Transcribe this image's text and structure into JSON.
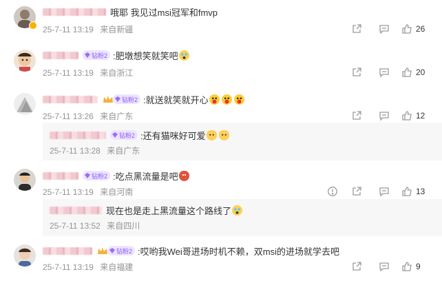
{
  "comments": [
    {
      "text": "哦耶 我见过msi冠军和fmvp",
      "date": "25-7-11 13:19",
      "location": "来自新疆",
      "likes": "26"
    },
    {
      "badge": "钻粉2",
      "text": ":肥墩想笑就笑吧",
      "date": "25-7-11 13:19",
      "location": "来自浙江",
      "likes": "20"
    },
    {
      "badge": "钻粉2",
      "text": ":就送就笑就开心",
      "date": "25-7-11 13:26",
      "location": "来自广东",
      "likes": "12",
      "reply": {
        "badge": "钻粉2",
        "text": ":还有猫咪好可爱",
        "date": "25-7-11 13:28",
        "location": "来自广东"
      }
    },
    {
      "badge": "钻粉2",
      "text": ":吃点黑流量是吧",
      "date": "25-7-11 13:19",
      "location": "来自河南",
      "likes": "13",
      "reply": {
        "text": "现在也是走上黑流量这个路线了",
        "date": "25-7-11 13:52",
        "location": "来自四川"
      }
    },
    {
      "badge": "钻粉2",
      "text": ":哎哟我Wei哥进场时机不赖，双msi的进场就学去吧",
      "date": "25-7-11 13:19",
      "location": "来自福建",
      "likes": "9"
    }
  ],
  "icons": {
    "share": "share-icon",
    "comment": "comment-icon",
    "like": "thumbs-up-icon",
    "report": "report-icon"
  },
  "colors": {
    "meta": "#939393",
    "badge_bg": "#ede4ff",
    "badge_fg": "#8a5cf6"
  }
}
